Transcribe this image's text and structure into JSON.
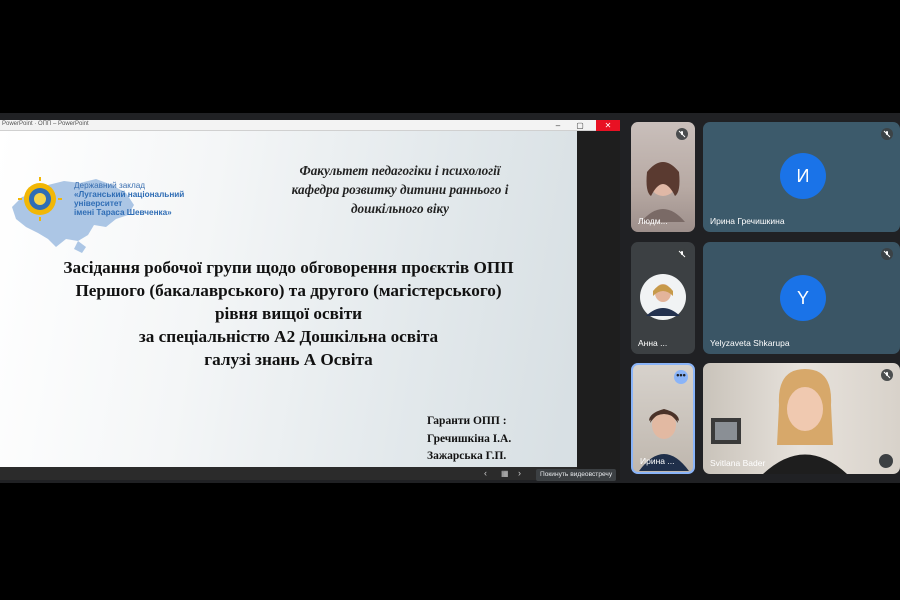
{
  "window": {
    "title": "PowerPoint · ОПП – PowerPoint",
    "controls": {
      "minimize": "–",
      "maximize": "▢",
      "close": "✕"
    }
  },
  "slide": {
    "logo": {
      "line1": "Державний заклад",
      "line2": "«Луганський національний",
      "line3": "університет",
      "line4": "імені Тараса Шевченка»"
    },
    "faculty": {
      "line1": "Факультет педагогіки і психології",
      "line2": "кафедра розвитку дитини раннього і",
      "line3": "дошкільного віку"
    },
    "title": {
      "line1": "Засідання робочої групи щодо обговорення проєктів ОПП",
      "line2": "Першого (бакалаврського) та другого (магістерського)",
      "line3": "рівня вищої освіти",
      "line4": "за спеціальністю А2 Дошкільна освіта",
      "line5": "галузі знань А Освіта"
    },
    "guarantors": {
      "label": "Гаранти ОПП :",
      "person1": "Гречишкіна І.А.",
      "person2": "Зажарська Г.П."
    },
    "nav": {
      "prev": "‹",
      "grid": "▦",
      "next": "›"
    }
  },
  "tooltip": {
    "leave": "Покинуть видеовстречу"
  },
  "participants": [
    {
      "name": "Людм...",
      "muted": true
    },
    {
      "name": "Ирина Гречишкина",
      "initial": "И",
      "avatar_color": "#1a73e8",
      "muted": true
    },
    {
      "name": "Анна ...",
      "muted": true
    },
    {
      "name": "Yelyzaveta Shkarupa",
      "initial": "Y",
      "avatar_color": "#1a73e8",
      "muted": true
    },
    {
      "name": "Ирина ...",
      "more": "•••"
    },
    {
      "name": "Svitlana Bader",
      "muted": true
    }
  ]
}
